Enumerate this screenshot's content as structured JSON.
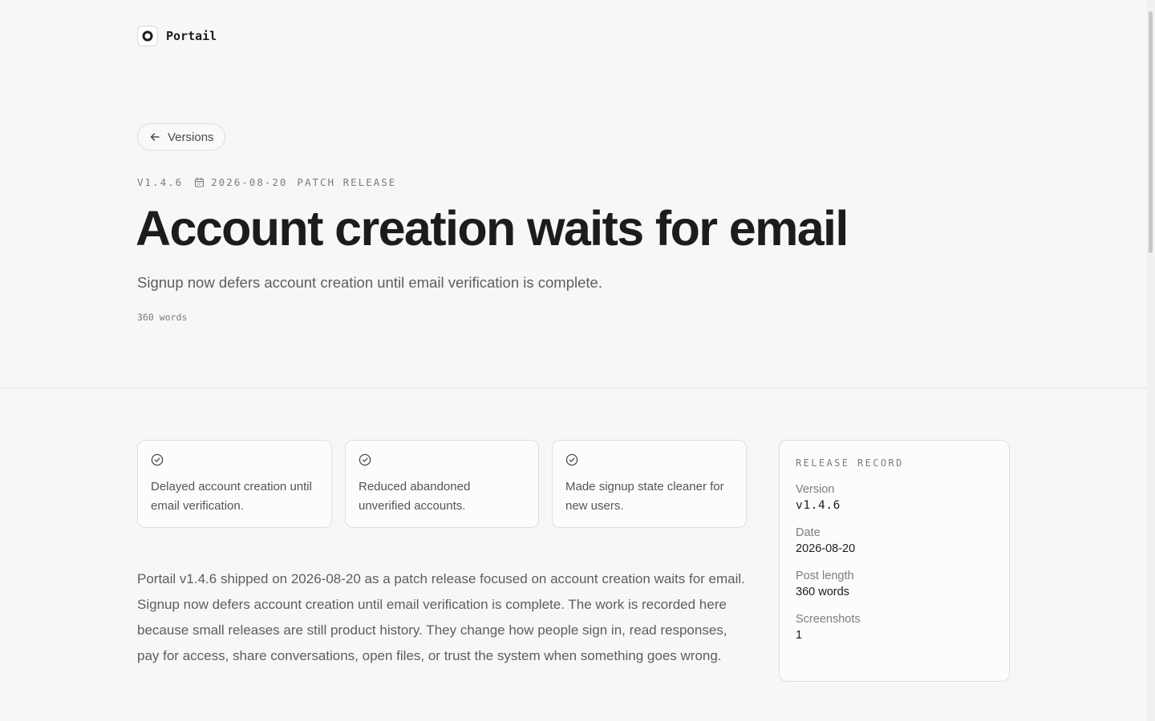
{
  "brand": {
    "name": "Portail",
    "logo_icon": "ring-logo-icon"
  },
  "back_button": {
    "label": "Versions",
    "icon": "arrow-left-icon"
  },
  "release": {
    "version": "V1.4.6",
    "date": "2026-08-20",
    "type": "PATCH RELEASE",
    "title": "Account creation waits for email",
    "subtitle": "Signup now defers account creation until email verification is complete.",
    "word_count": "360 words"
  },
  "highlights": [
    {
      "icon": "check-circle-icon",
      "text": "Delayed account creation until email verification."
    },
    {
      "icon": "check-circle-icon",
      "text": "Reduced abandoned unverified accounts."
    },
    {
      "icon": "check-circle-icon",
      "text": "Made signup state cleaner for new users."
    }
  ],
  "body": "Portail v1.4.6 shipped on 2026-08-20 as a patch release focused on account creation waits for email. Signup now defers account creation until email verification is complete. The work is recorded here because small releases are still product history. They change how people sign in, read responses, pay for access, share conversations, open files, or trust the system when something goes wrong.",
  "record": {
    "heading": "RELEASE RECORD",
    "items": [
      {
        "label": "Version",
        "value": "v1.4.6"
      },
      {
        "label": "Date",
        "value": "2026-08-20"
      },
      {
        "label": "Post length",
        "value": "360 words"
      },
      {
        "label": "Screenshots",
        "value": "1"
      }
    ]
  },
  "colors": {
    "background": "#f7f7f7",
    "text": "#1c1c1e",
    "muted": "#7c7c80",
    "border": "#dedede"
  }
}
